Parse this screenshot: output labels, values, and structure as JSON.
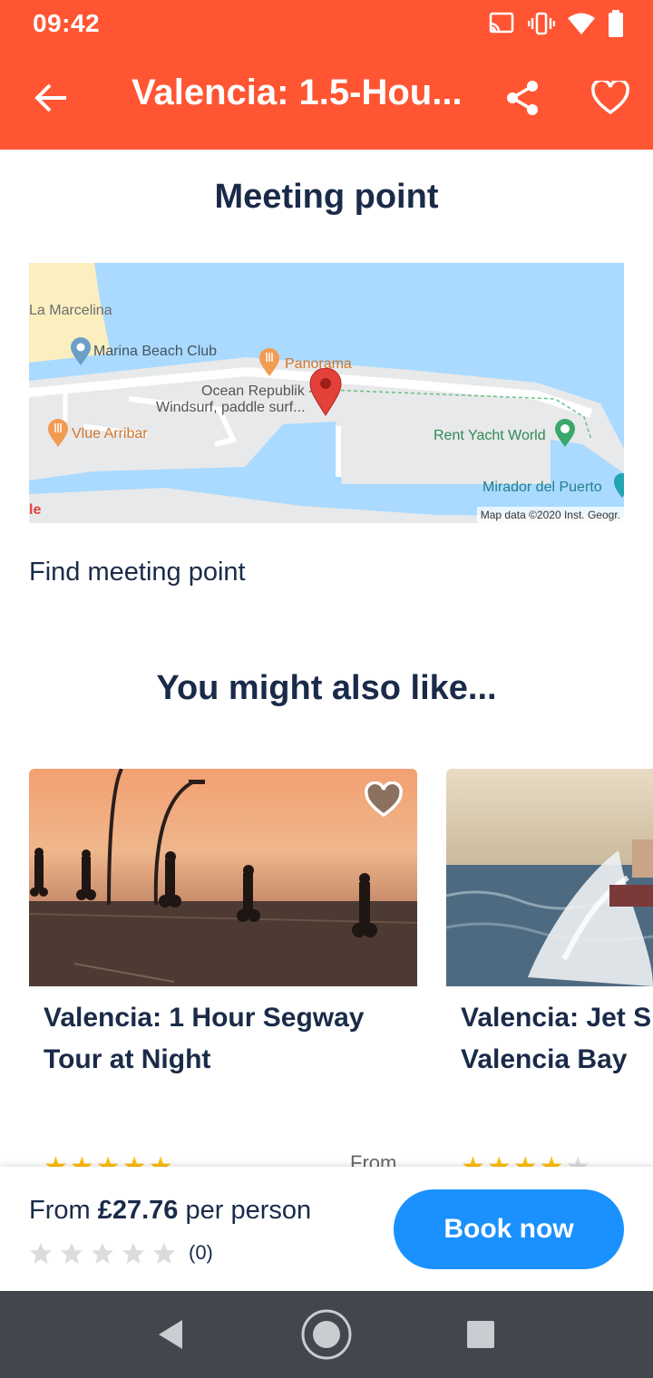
{
  "status": {
    "time": "09:42"
  },
  "appbar": {
    "title": "Valencia: 1.5-Hou..."
  },
  "meeting": {
    "heading": "Meeting point",
    "map_labels": {
      "marcelina": "La Marcelina",
      "marina": "Marina Beach Club",
      "panorama": "Panorama",
      "ocean1": "Ocean Republik -",
      "ocean2": "Windsurf, paddle surf...",
      "vlue": "Vlue Arribar",
      "rent": "Rent Yacht World",
      "mirador": "Mirador del Puerto",
      "google_fragment": "le",
      "attribution": "Map data ©2020 Inst. Geogr."
    },
    "link": "Find meeting point"
  },
  "related": {
    "heading": "You might also like...",
    "cards": [
      {
        "title_line1": "Valencia: 1 Hour Segway",
        "title_line2": "Tour at Night"
      },
      {
        "title_line1": "Valencia: Jet Sk",
        "title_line2": "Valencia Bay"
      }
    ],
    "peek_from": "From"
  },
  "booking": {
    "price_prefix": "From ",
    "price": "£27.76",
    "price_suffix": " per person",
    "rating_count": "(0)",
    "button": "Book now"
  },
  "colors": {
    "brand": "#ff5533",
    "accent": "#1a91ff",
    "text": "#1a2b49"
  }
}
